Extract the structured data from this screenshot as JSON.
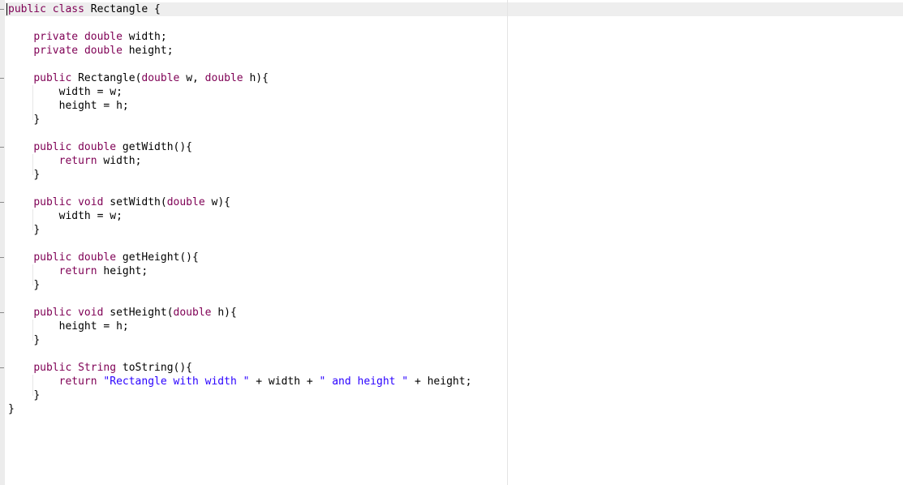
{
  "editor": {
    "lines": [
      [
        "public class Rectangle {"
      ],
      [
        ""
      ],
      [
        "    private double width;"
      ],
      [
        "    private double height;"
      ],
      [
        ""
      ],
      [
        "    public Rectangle(double w, double h){"
      ],
      [
        "        width = w;"
      ],
      [
        "        height = h;"
      ],
      [
        "    }"
      ],
      [
        ""
      ],
      [
        "    public double getWidth(){"
      ],
      [
        "        return width;"
      ],
      [
        "    }"
      ],
      [
        ""
      ],
      [
        "    public void setWidth(double w){"
      ],
      [
        "        width = w;"
      ],
      [
        "    }"
      ],
      [
        ""
      ],
      [
        "    public double getHeight(){"
      ],
      [
        "        return height;"
      ],
      [
        "    }"
      ],
      [
        ""
      ],
      [
        "    public void setHeight(double h){"
      ],
      [
        "        height = h;"
      ],
      [
        "    }"
      ],
      [
        ""
      ],
      [
        "    public String toString(){"
      ],
      [
        "        return \"Rectangle with width \" + width + \" and height \" + height;"
      ],
      [
        "    }"
      ],
      [
        "}"
      ]
    ]
  },
  "colors": {
    "keyword": "#7f0055",
    "string": "#2a00ff",
    "identifier": "#000000",
    "current_line": "#eeeeee"
  }
}
